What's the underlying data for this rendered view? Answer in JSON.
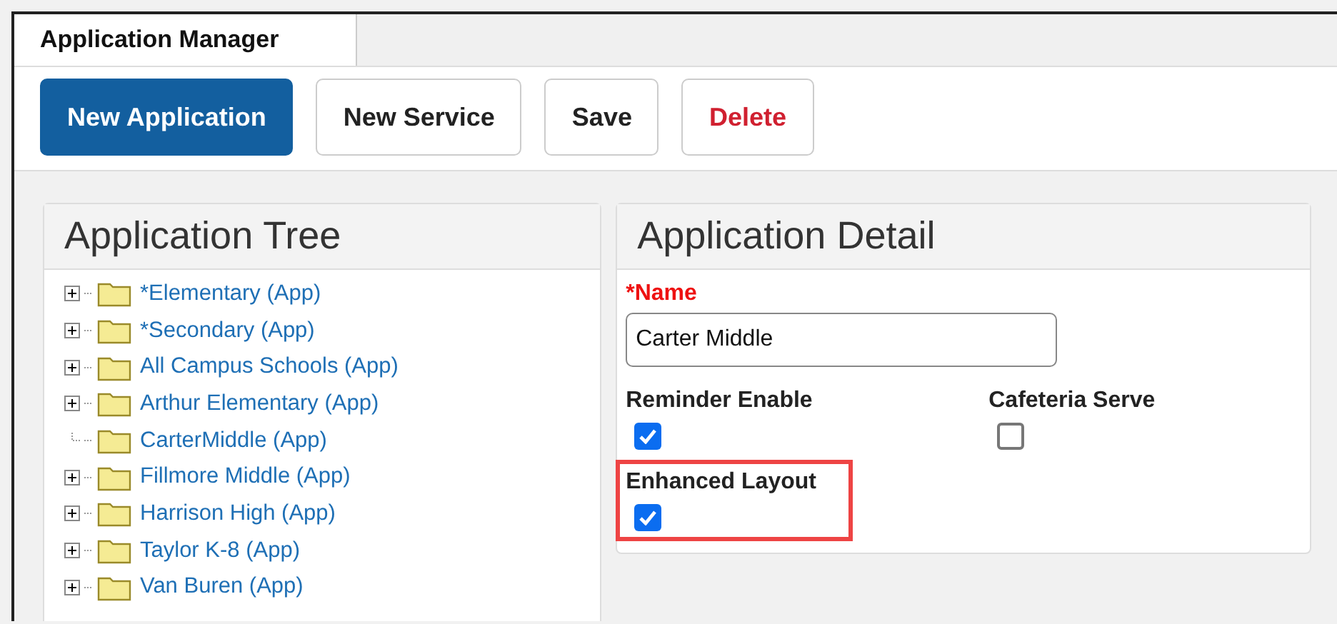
{
  "tabs": [
    {
      "label": "Application Manager",
      "selected": true
    }
  ],
  "toolbar": [
    {
      "label": "New Application",
      "kind": "primary"
    },
    {
      "label": "New Service",
      "kind": "plain"
    },
    {
      "label": "Save",
      "kind": "plain"
    },
    {
      "label": "Delete",
      "kind": "danger"
    }
  ],
  "tree": {
    "title": "Application Tree",
    "items": [
      {
        "label": "*Elementary (App)",
        "expandable": true
      },
      {
        "label": "*Secondary (App)",
        "expandable": true
      },
      {
        "label": "All Campus Schools (App)",
        "expandable": true
      },
      {
        "label": "Arthur Elementary (App)",
        "expandable": true
      },
      {
        "label": "CarterMiddle (App)",
        "expandable": false
      },
      {
        "label": "Fillmore Middle (App)",
        "expandable": true
      },
      {
        "label": "Harrison High (App)",
        "expandable": true
      },
      {
        "label": "Taylor K-8 (App)",
        "expandable": true
      },
      {
        "label": "Van Buren (App)",
        "expandable": true
      }
    ]
  },
  "detail": {
    "title": "Application Detail",
    "name_field": {
      "required_mark": "*",
      "label": "Name",
      "value": "Carter Middle"
    },
    "checkboxes": [
      {
        "label": "Reminder Enable",
        "checked": true,
        "highlighted": false
      },
      {
        "label": "Cafeteria Serve",
        "checked": false,
        "highlighted": false
      },
      {
        "label": "Enhanced Layout",
        "checked": true,
        "highlighted": true
      }
    ]
  }
}
